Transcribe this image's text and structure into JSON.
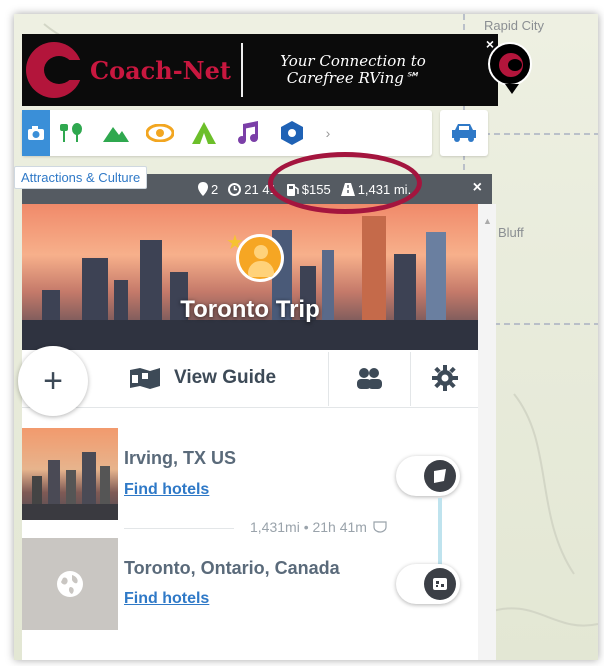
{
  "map": {
    "labels": {
      "rapid_city": "Rapid City",
      "bluff": "Bluff"
    }
  },
  "banner": {
    "brand": "Coach-Net",
    "tagline_line1": "Your Connection to",
    "tagline_line2": "Carefree RVing℠",
    "close": "×"
  },
  "categories": {
    "icons": [
      "camera-icon",
      "restaurant-icon",
      "mountain-icon",
      "eye-icon",
      "campground-icon",
      "music-icon",
      "hexagon-icon"
    ],
    "tooltip": "Attractions & Culture",
    "next_arrow": "›",
    "colors": {
      "camera": "#3a8fd8",
      "restaurant": "#2fa84f",
      "mountain": "#2fa84f",
      "eye": "#f2a621",
      "campground": "#6cbf2a",
      "music": "#7b3fa8",
      "hexagon": "#1f62b5",
      "car": "#2f79c7"
    }
  },
  "trip_stats": {
    "stops": "2",
    "duration": "21 41",
    "cost": "$155",
    "distance": "1,431 mi.",
    "close": "×"
  },
  "trip": {
    "title": "Toronto Trip"
  },
  "actions": {
    "add": "+",
    "view_guide": "View Guide"
  },
  "stops": [
    {
      "name": "Irving, TX US",
      "link": "Find hotels"
    },
    {
      "name": "Toronto, Ontario, Canada",
      "link": "Find hotels"
    }
  ],
  "leg": {
    "distance": "1,431mi • 21h 41m"
  },
  "accent": {
    "highlight_ring": "#a4153e",
    "link": "#2f79c7",
    "stats_bar": "#555b62"
  }
}
